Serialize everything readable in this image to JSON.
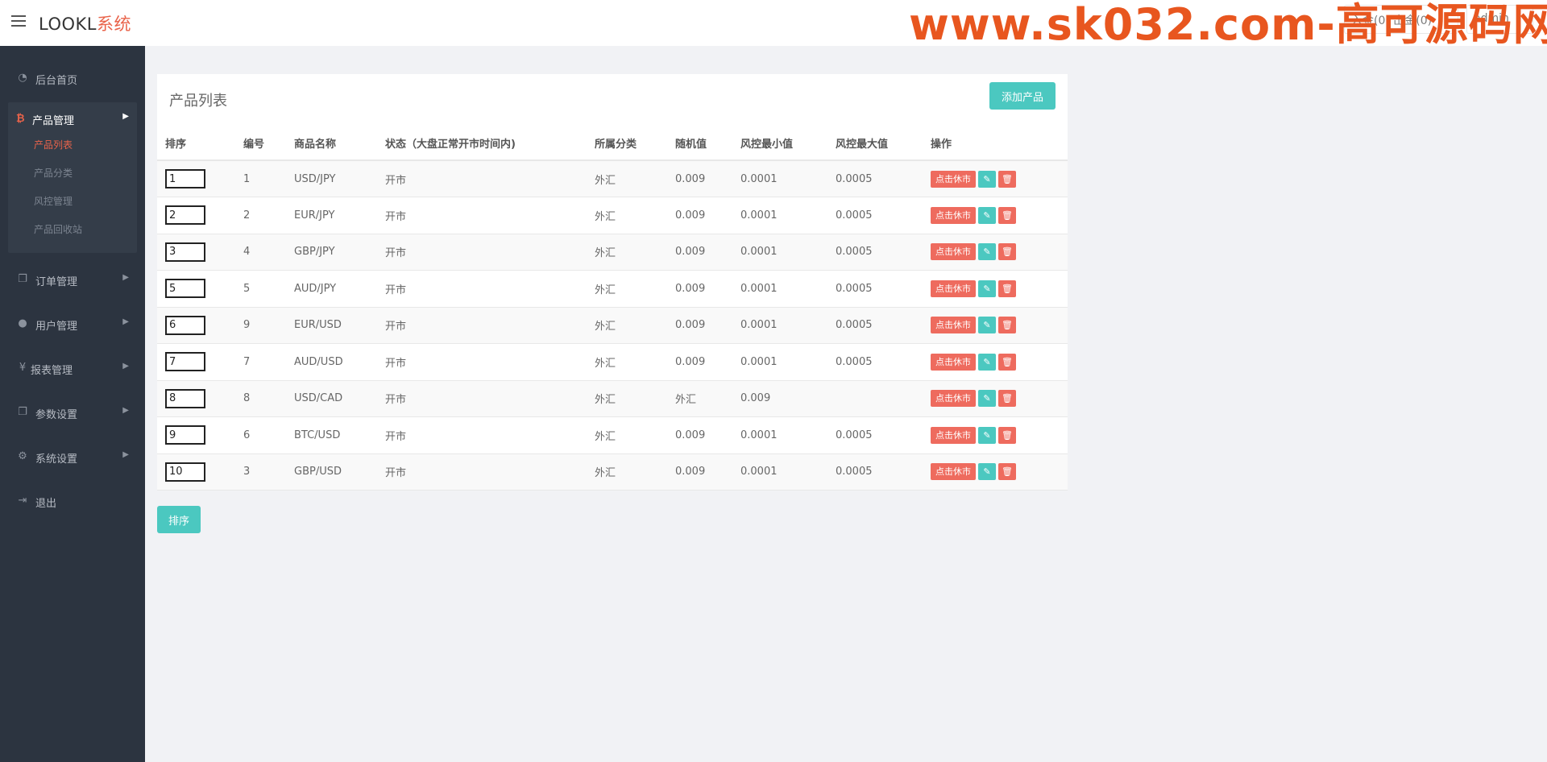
{
  "header": {
    "logo_main": "LOOKL",
    "logo_accent": "系统",
    "watermark": "www.sk032.com-高可源码网",
    "btn_deposit": "入金(0) 出金(0)",
    "btn_user": "admin"
  },
  "sidebar": {
    "items": [
      {
        "label": "后台首页",
        "icon": "dashboard-icon"
      },
      {
        "label": "产品管理",
        "icon": "bitcoin-icon"
      },
      {
        "label": "订单管理",
        "icon": "copy-icon"
      },
      {
        "label": "用户管理",
        "icon": "user-icon"
      },
      {
        "label": "报表管理",
        "icon": "yen-icon"
      },
      {
        "label": "参数设置",
        "icon": "copy-icon"
      },
      {
        "label": "系统设置",
        "icon": "gears-icon"
      },
      {
        "label": "退出",
        "icon": "sign-out-icon"
      }
    ],
    "sub_items": [
      {
        "label": "产品列表",
        "active": true
      },
      {
        "label": "产品分类",
        "active": false
      },
      {
        "label": "风控管理",
        "active": false
      },
      {
        "label": "产品回收站",
        "active": false
      }
    ]
  },
  "panel": {
    "title": "产品列表",
    "add_button": "添加产品"
  },
  "table": {
    "headers": [
      "排序",
      "编号",
      "商品名称",
      "状态（大盘正常开市时间内)",
      "所属分类",
      "随机值",
      "风控最小值",
      "风控最大值",
      "操作"
    ],
    "rows": [
      {
        "sort": "1",
        "id": "1",
        "name": "USD/JPY",
        "status": "开市",
        "category": "外汇",
        "random": "0.009",
        "min": "0.0001",
        "max": "0.0005"
      },
      {
        "sort": "2",
        "id": "2",
        "name": "EUR/JPY",
        "status": "开市",
        "category": "外汇",
        "random": "0.009",
        "min": "0.0001",
        "max": "0.0005"
      },
      {
        "sort": "3",
        "id": "4",
        "name": "GBP/JPY",
        "status": "开市",
        "category": "外汇",
        "random": "0.009",
        "min": "0.0001",
        "max": "0.0005"
      },
      {
        "sort": "5",
        "id": "5",
        "name": "AUD/JPY",
        "status": "开市",
        "category": "外汇",
        "random": "0.009",
        "min": "0.0001",
        "max": "0.0005"
      },
      {
        "sort": "6",
        "id": "9",
        "name": "EUR/USD",
        "status": "开市",
        "category": "外汇",
        "random": "0.009",
        "min": "0.0001",
        "max": "0.0005"
      },
      {
        "sort": "7",
        "id": "7",
        "name": "AUD/USD",
        "status": "开市",
        "category": "外汇",
        "random": "0.009",
        "min": "0.0001",
        "max": "0.0005"
      },
      {
        "sort": "8",
        "id": "8",
        "name": "USD/CAD",
        "status": "开市",
        "category": "外汇",
        "random": "外汇",
        "min": "0.009",
        "max": ""
      },
      {
        "sort": "9",
        "id": "6",
        "name": "BTC/USD",
        "status": "开市",
        "category": "外汇",
        "random": "0.009",
        "min": "0.0001",
        "max": "0.0005"
      },
      {
        "sort": "10",
        "id": "3",
        "name": "GBP/USD",
        "status": "开市",
        "category": "外汇",
        "random": "0.009",
        "min": "0.0001",
        "max": "0.0005"
      }
    ],
    "action_pause": "点击休市"
  },
  "footer": {
    "sort_button": "排序"
  },
  "colors": {
    "accent": "#e9634a",
    "teal": "#4bc8c0",
    "danger": "#ee6b5e",
    "sidebar_bg": "#2c3440"
  }
}
